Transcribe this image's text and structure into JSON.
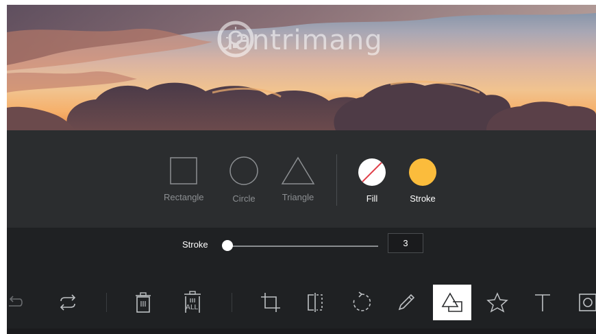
{
  "watermark": {
    "text": "uantrimang"
  },
  "shape_tools": [
    {
      "label": "Rectangle",
      "icon": "rectangle-icon"
    },
    {
      "label": "Circle",
      "icon": "circle-icon"
    },
    {
      "label": "Triangle",
      "icon": "triangle-icon"
    }
  ],
  "style_options": {
    "fill": {
      "label": "Fill",
      "color": "none"
    },
    "stroke": {
      "label": "Stroke",
      "color": "#fbbc3c"
    }
  },
  "stroke_slider": {
    "label": "Stroke",
    "value": "3",
    "level": 0.03
  },
  "toolbar": {
    "items": [
      "redo-icon",
      "flip-icon",
      "delete-icon",
      "delete-all-icon",
      "crop-icon",
      "mirror-icon",
      "rotate-icon",
      "draw-icon",
      "shape-icon",
      "sticker-icon",
      "text-icon",
      "mask-icon"
    ],
    "delete_all_label": "ALL",
    "active": "shape-icon"
  },
  "colors": {
    "panel_bg": "#2b2d2f",
    "toolbar_bg": "#1f2123",
    "accent": "#fbbc3c",
    "fill_slash": "#e0404a"
  }
}
